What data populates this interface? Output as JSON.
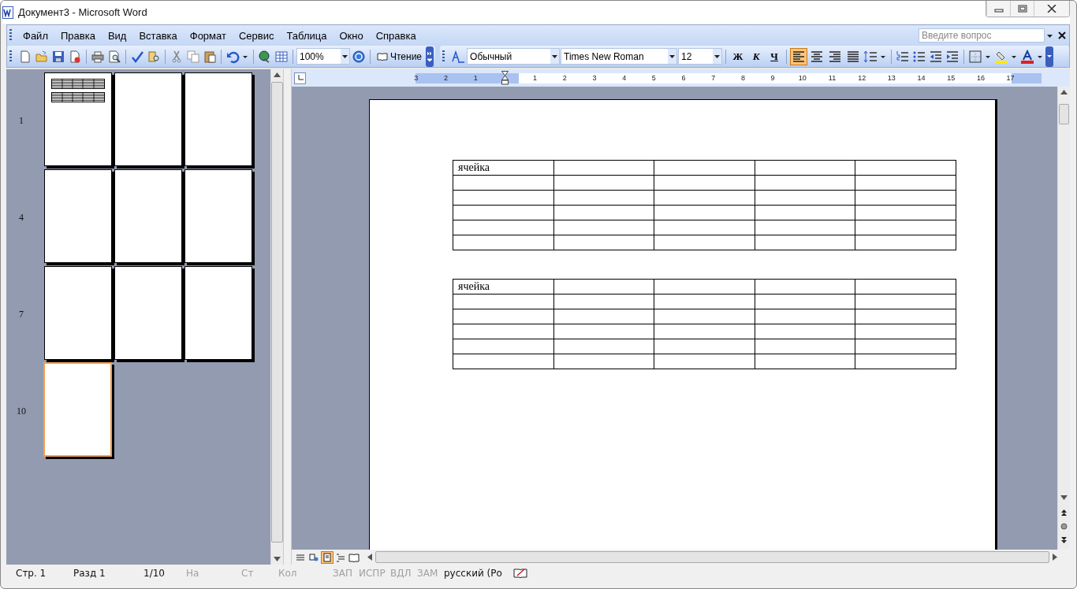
{
  "window": {
    "title": "Документ3 - Microsoft Word"
  },
  "menu": [
    "Файл",
    "Правка",
    "Вид",
    "Вставка",
    "Формат",
    "Сервис",
    "Таблица",
    "Окно",
    "Справка"
  ],
  "help_search": {
    "placeholder": "Введите вопрос"
  },
  "toolbar": {
    "zoom": "100%",
    "read_button": "Чтение",
    "style": "Обычный",
    "font": "Times New Roman",
    "size": "12",
    "bold": "Ж",
    "italic": "К",
    "underline": "Ч",
    "align_buttons": [
      {
        "kind": "left",
        "selected": true
      },
      {
        "kind": "center",
        "selected": false
      },
      {
        "kind": "right",
        "selected": false
      },
      {
        "kind": "justify",
        "selected": false
      }
    ]
  },
  "ruler": {
    "left_labels": [
      "3",
      "2",
      "1"
    ],
    "right_labels": [
      "1",
      "2",
      "3",
      "4",
      "5",
      "6",
      "7",
      "8",
      "9",
      "10",
      "11",
      "12",
      "13",
      "14",
      "15",
      "16",
      "17"
    ]
  },
  "thumbnails": {
    "row_labels": [
      "1",
      "4",
      "7",
      "10"
    ],
    "pages": [
      {
        "kind": "tables",
        "selected": false
      },
      {
        "kind": "blank",
        "selected": false
      },
      {
        "kind": "blank",
        "selected": false
      },
      {
        "kind": "blank",
        "selected": false
      },
      {
        "kind": "blank",
        "selected": false
      },
      {
        "kind": "blank",
        "selected": false
      },
      {
        "kind": "blank",
        "selected": false
      },
      {
        "kind": "blank",
        "selected": false
      },
      {
        "kind": "blank",
        "selected": false
      },
      {
        "kind": "blank",
        "selected": true
      }
    ]
  },
  "document": {
    "tables": [
      {
        "rows": [
          [
            "ячейка",
            "",
            "",
            "",
            ""
          ],
          [
            "",
            "",
            "",
            "",
            ""
          ],
          [
            "",
            "",
            "",
            "",
            ""
          ],
          [
            "",
            "",
            "",
            "",
            ""
          ],
          [
            "",
            "",
            "",
            "",
            ""
          ],
          [
            "",
            "",
            "",
            "",
            ""
          ]
        ]
      },
      {
        "rows": [
          [
            "ячейка",
            "",
            "",
            "",
            ""
          ],
          [
            "",
            "",
            "",
            "",
            ""
          ],
          [
            "",
            "",
            "",
            "",
            ""
          ],
          [
            "",
            "",
            "",
            "",
            ""
          ],
          [
            "",
            "",
            "",
            "",
            ""
          ],
          [
            "",
            "",
            "",
            "",
            ""
          ]
        ]
      }
    ]
  },
  "view_buttons": [
    {
      "kind": "normal",
      "selected": false
    },
    {
      "kind": "web",
      "selected": false
    },
    {
      "kind": "print",
      "selected": true
    },
    {
      "kind": "outline",
      "selected": false
    },
    {
      "kind": "reading",
      "selected": false
    }
  ],
  "status_bar": [
    {
      "text": "Стр. 1",
      "disabled": false
    },
    {
      "text": "Разд 1",
      "disabled": false
    },
    {
      "text": "1/10",
      "disabled": false
    },
    {
      "text": "На",
      "disabled": true
    },
    {
      "text": "Ст",
      "disabled": true
    },
    {
      "text": "Кол",
      "disabled": true
    },
    {
      "text": "ЗАП",
      "disabled": true
    },
    {
      "text": "ИСПР",
      "disabled": true
    },
    {
      "text": "ВДЛ",
      "disabled": true
    },
    {
      "text": "ЗАМ",
      "disabled": true
    },
    {
      "text": "русский (Ро",
      "disabled": false
    }
  ]
}
